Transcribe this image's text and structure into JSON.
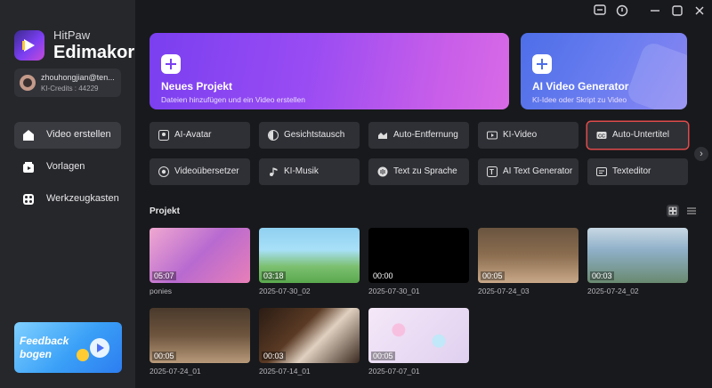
{
  "app": {
    "brand_line1": "HitPaw",
    "brand_line2": "Edimakor"
  },
  "account": {
    "name": "zhouhongjian@ten...",
    "credits": "KI-Credits : 44229"
  },
  "sidebar": {
    "items": [
      {
        "label": "Video erstellen",
        "icon": "home-icon",
        "active": true
      },
      {
        "label": "Vorlagen",
        "icon": "templates-icon",
        "active": false
      },
      {
        "label": "Werkzeugkasten",
        "icon": "toolbox-icon",
        "active": false
      }
    ],
    "banner": {
      "line1": "Feedback",
      "line2": "bogen"
    }
  },
  "topbar": {
    "icons": [
      "feedback-icon",
      "info-icon",
      "minimize-icon",
      "maximize-icon",
      "close-icon"
    ]
  },
  "hero": {
    "new_project": {
      "title": "Neues Projekt",
      "subtitle": "Dateien hinzufügen und ein Video erstellen"
    },
    "ai_video": {
      "title": "AI Video Generator",
      "subtitle": "KI-Idee oder Skript zu Video"
    }
  },
  "tools": [
    {
      "label": "AI-Avatar",
      "icon": "avatar-icon"
    },
    {
      "label": "Gesichtstausch",
      "icon": "face-swap-icon"
    },
    {
      "label": "Auto-Entfernung",
      "icon": "auto-remove-icon"
    },
    {
      "label": "KI-Video",
      "icon": "ai-video-icon"
    },
    {
      "label": "Auto-Untertitel",
      "icon": "subtitle-cc-icon",
      "selected": true
    },
    {
      "label": "Videoübersetzer",
      "icon": "translate-icon"
    },
    {
      "label": "KI-Musik",
      "icon": "music-icon"
    },
    {
      "label": "Text zu Sprache",
      "icon": "tts-icon"
    },
    {
      "label": "AI Text Generator",
      "icon": "text-generator-icon"
    },
    {
      "label": "Texteditor",
      "icon": "text-editor-icon"
    }
  ],
  "projects": {
    "title": "Projekt",
    "items": [
      {
        "name": "ponies",
        "duration": "05:07",
        "color": "#c86ba8"
      },
      {
        "name": "2025-07-30_02",
        "duration": "03:18",
        "color": "#6fb4d8"
      },
      {
        "name": "2025-07-30_01",
        "duration": "00:00",
        "color": "#000000"
      },
      {
        "name": "2025-07-24_03",
        "duration": "00:05",
        "color": "#8a6a4a"
      },
      {
        "name": "2025-07-24_02",
        "duration": "00:03",
        "color": "#8fb0c8"
      },
      {
        "name": "2025-07-24_01",
        "duration": "00:05",
        "color": "#6e553e"
      },
      {
        "name": "2025-07-14_01",
        "duration": "00:03",
        "color": "#3a2a20"
      },
      {
        "name": "2025-07-07_01",
        "duration": "00:05",
        "color": "#e8d8f0"
      }
    ]
  },
  "colors": {
    "accent": "#7a3ff0",
    "selection": "#e04b4b",
    "background": "#18191c",
    "sidebar": "#26272b"
  }
}
